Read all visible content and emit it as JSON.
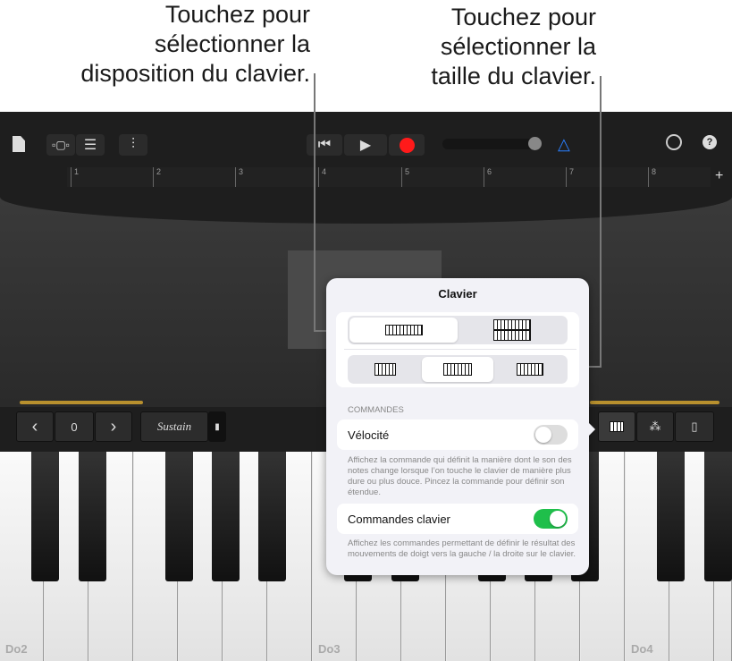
{
  "callouts": {
    "left": [
      "Touchez pour",
      "sélectionner la",
      "disposition du clavier."
    ],
    "right": [
      "Touchez pour",
      "sélectionner la",
      "taille du clavier."
    ]
  },
  "toolbar": {
    "icons": [
      "document-icon",
      "browser-icon",
      "tracks-icon",
      "mixer-icon",
      "go-to-start-icon",
      "play-icon",
      "record-icon",
      "volume-slider",
      "metronome-icon",
      "settings-icon",
      "help-icon"
    ],
    "record_color": "#ff1a1a",
    "metronome_color": "#2a7fff",
    "help": "?"
  },
  "ruler": {
    "bars": [
      "1",
      "2",
      "3",
      "4",
      "5",
      "6",
      "7",
      "8"
    ],
    "add": "+"
  },
  "controls": {
    "octave_down": "‹",
    "octave": "0",
    "octave_up": "›",
    "sustain": "Sustain"
  },
  "popover": {
    "title": "Clavier",
    "section": "COMMANDES",
    "velocity": {
      "label": "Vélocité",
      "on": false,
      "help": "Affichez la commande qui définit la manière dont le son des notes change lorsque l’on touche le clavier de manière plus dure ou plus douce. Pincez la commande pour définir son étendue."
    },
    "keyboard_controls": {
      "label": "Commandes clavier",
      "on": true,
      "help": "Affichez les commandes permettant de définir le résultat des mouvements de doigt vers la gauche / la droite sur le clavier."
    },
    "layout_selected": "single",
    "size_selected": "medium",
    "accent": "#1fbf4b"
  },
  "keyboard": {
    "notes": [
      "Do2",
      "Do3",
      "Do4"
    ]
  }
}
